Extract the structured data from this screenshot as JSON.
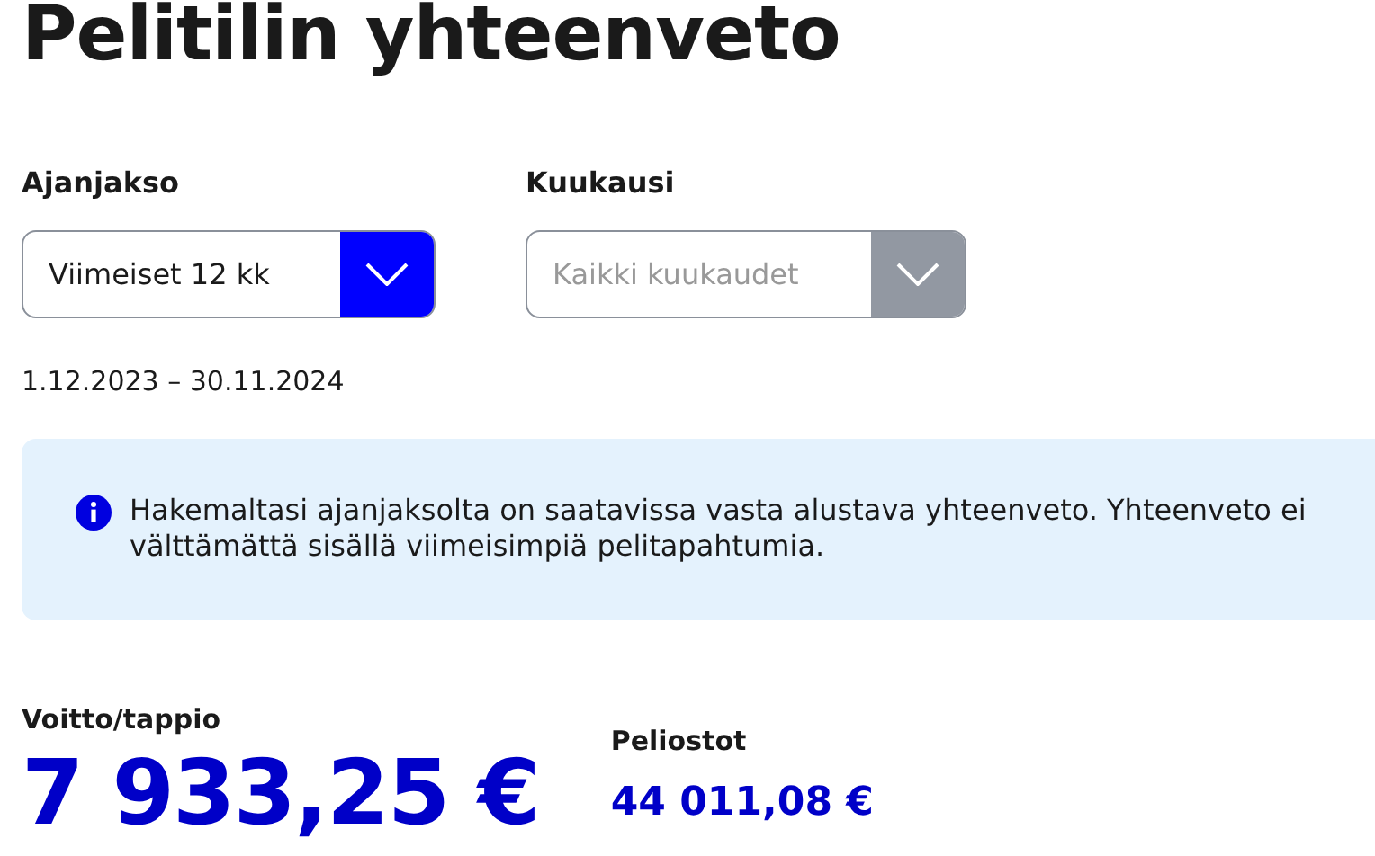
{
  "title": "Pelitilin yhteenveto",
  "filters": [
    {
      "label": "Ajanjakso",
      "value": "Viimeiset 12 kk",
      "disabled": false
    },
    {
      "label": "Kuukausi",
      "placeholder": "Kaikki kuukaudet",
      "disabled": true
    }
  ],
  "date_range": "1.12.2023 – 30.11.2024",
  "notice": "Hakemaltasi ajanjaksolta on saatavissa vasta alustava yhteenveto. Yhteenveto ei välttämättä sisällä viimeisimpiä pelitapahtumia.",
  "stats": [
    {
      "kind": "primary",
      "label": "Voitto/tappio",
      "value": "7 933,25 €"
    },
    {
      "kind": "secondary",
      "label": "Peliostot",
      "value": "44 011,08 €"
    }
  ]
}
